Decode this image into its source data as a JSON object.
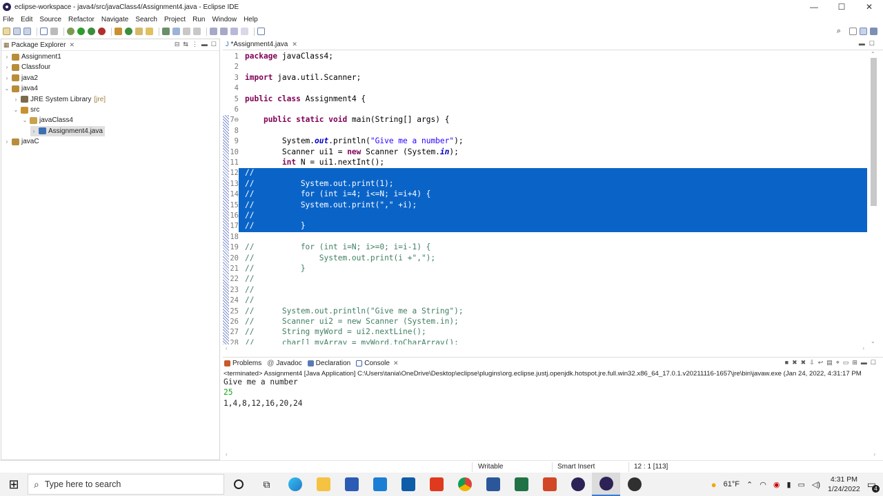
{
  "window": {
    "title": "eclipse-workspace - java4/src/javaClass4/Assignment4.java - Eclipse IDE",
    "controls": [
      "—",
      "☐",
      "✕"
    ]
  },
  "menu": [
    "File",
    "Edit",
    "Source",
    "Refactor",
    "Navigate",
    "Search",
    "Project",
    "Run",
    "Window",
    "Help"
  ],
  "package_explorer": {
    "title": "Package Explorer",
    "items": [
      {
        "label": "Assignment1",
        "arrow": "›",
        "level": 0
      },
      {
        "label": "Classfour",
        "arrow": "›",
        "level": 0
      },
      {
        "label": "java2",
        "arrow": "›",
        "level": 0
      },
      {
        "label": "java4",
        "arrow": "⌄",
        "level": 0
      },
      {
        "label": "JRE System Library",
        "suffix": "[jre]",
        "arrow": "›",
        "level": 1
      },
      {
        "label": "src",
        "arrow": "⌄",
        "level": 1
      },
      {
        "label": "javaClass4",
        "arrow": "⌄",
        "level": 2
      },
      {
        "label": "Assignment4.java",
        "arrow": "›",
        "level": 3
      },
      {
        "label": "javaC",
        "arrow": "›",
        "level": 0
      }
    ]
  },
  "editor": {
    "tab_label": "*Assignment4.java",
    "lines": [
      {
        "n": "1",
        "text": "package javaClass4;"
      },
      {
        "n": "2",
        "text": ""
      },
      {
        "n": "3",
        "text": "import java.util.Scanner;"
      },
      {
        "n": "4",
        "text": ""
      },
      {
        "n": "5",
        "text": "public class Assignment4 {"
      },
      {
        "n": "6",
        "text": ""
      },
      {
        "n": "7⊖",
        "text": "    public static void main(String[] args) {"
      },
      {
        "n": "8",
        "text": ""
      },
      {
        "n": "9",
        "text": "        System.out.println(\"Give me a number\");"
      },
      {
        "n": "10",
        "text": "        Scanner ui1 = new Scanner (System.in);"
      },
      {
        "n": "11",
        "text": "        int N = ui1.nextInt();"
      },
      {
        "n": "12",
        "text": "//"
      },
      {
        "n": "13",
        "text": "//          System.out.print(1);"
      },
      {
        "n": "14",
        "text": "//          for (int i=4; i<=N; i=i+4) {"
      },
      {
        "n": "15",
        "text": "//          System.out.print(\",\" +i);"
      },
      {
        "n": "16",
        "text": "//"
      },
      {
        "n": "17",
        "text": "//          }"
      },
      {
        "n": "18",
        "text": ""
      },
      {
        "n": "19",
        "text": "//          for (int i=N; i>=0; i=i-1) {"
      },
      {
        "n": "20",
        "text": "//              System.out.print(i +\",\");"
      },
      {
        "n": "21",
        "text": "//          }"
      },
      {
        "n": "22",
        "text": "//"
      },
      {
        "n": "23",
        "text": "//"
      },
      {
        "n": "24",
        "text": "//"
      },
      {
        "n": "25",
        "text": "//      System.out.println(\"Give me a String\");"
      },
      {
        "n": "26",
        "text": "//      Scanner ui2 = new Scanner (System.in);"
      },
      {
        "n": "27",
        "text": "//      String myWord = ui2.nextLine();"
      },
      {
        "n": "28",
        "text": "//      char[] myArray = myWord.toCharArray();"
      }
    ]
  },
  "console_panel": {
    "tabs": [
      "Problems",
      "Javadoc",
      "Declaration",
      "Console"
    ],
    "terminated": "<terminated> Assignment4 [Java Application] C:\\Users\\tania\\OneDrive\\Desktop\\eclipse\\plugins\\org.eclipse.justj.openjdk.hotspot.jre.full.win32.x86_64_17.0.1.v20211116-1657\\jre\\bin\\javaw.exe  (Jan 24, 2022, 4:31:17 PM",
    "output": [
      "Give me a number",
      "25",
      "1,4,8,12,16,20,24"
    ]
  },
  "status": {
    "writable": "Writable",
    "insert": "Smart Insert",
    "position": "12 : 1 [113]"
  },
  "taskbar": {
    "search_placeholder": "Type here to search",
    "weather": "61°F",
    "time": "4:31 PM",
    "date": "1/24/2022",
    "notifications": "4"
  },
  "colors": {
    "selection": "#0a64c8",
    "comment": "#3f7f5f",
    "keyword": "#7f0055",
    "console_input": "#19a319"
  }
}
